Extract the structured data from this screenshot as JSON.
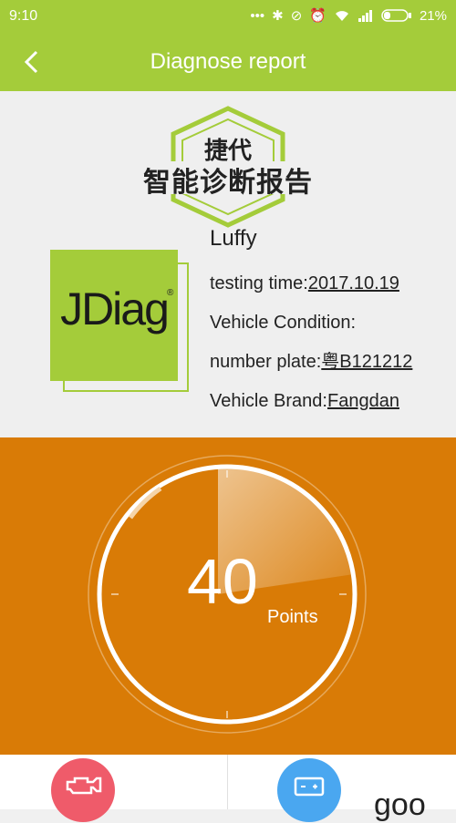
{
  "status": {
    "time": "9:10",
    "battery": "21%"
  },
  "appbar": {
    "title": "Diagnose report"
  },
  "badge": {
    "line1": "捷代",
    "line2": "智能诊断报告"
  },
  "logo": {
    "text": "JDiag",
    "reg": "®"
  },
  "info": {
    "name": "Luffy",
    "testing_time_label": "testing time:",
    "testing_time": "2017.10.19",
    "vehicle_condition_label": "Vehicle Condition:",
    "number_plate_label": "number plate:",
    "number_plate": "粤B121212",
    "vehicle_brand_label": "Vehicle Brand:",
    "vehicle_brand": "Fangdan"
  },
  "score": {
    "value": "40",
    "unit": "Points",
    "fraction": 0.4
  },
  "bottom": {
    "partial_text": "goo"
  },
  "colors": {
    "primary": "#a4cc3a",
    "score_bg": "#d97b06",
    "engine": "#ef5b6a",
    "battery": "#4aa7f0"
  }
}
